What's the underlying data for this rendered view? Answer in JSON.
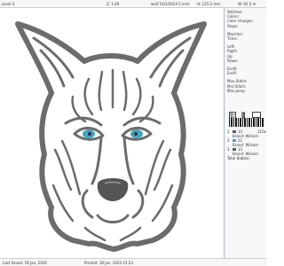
{
  "topbar": {
    "level": "Level 3",
    "zoom": "Z: 1.49",
    "file": "wolf 10/1/2024 5 inch",
    "dims": "H: 125.2 mm",
    "width": "W: 92.5 m"
  },
  "panel": {
    "stitches": "Stitches:",
    "colors": "Colors:",
    "color_changes": "Color changes:",
    "stops": "Stops:",
    "machine": "Machine:",
    "trims": "Trims:",
    "left": "Left:",
    "right": "Right:",
    "up": "Up:",
    "down": "Down:",
    "endx": "EndX:",
    "endy": "EndY:",
    "max_stitch": "Max.Stitch:",
    "min_stitch": "Min.Stitch:",
    "max_jump": "Max.Jump:"
  },
  "toolbar": {
    "icon1": "grid-icon",
    "icon2": "ruler-icon",
    "icon3": "monitor-icon"
  },
  "color_table": [
    {
      "index": "1",
      "code": "13",
      "stitches": "110x",
      "color": "#5a5a5a"
    },
    {
      "index": "",
      "code": "Brand: Wilcom",
      "stitches": "",
      "color": ""
    },
    {
      "index": "2",
      "code": "21",
      "stitches": "",
      "color": "#3aa0c8"
    },
    {
      "index": "",
      "code": "Brand: Wilcom",
      "stitches": "",
      "color": ""
    },
    {
      "index": "3",
      "code": "13",
      "stitches": "",
      "color": "#5a5a5a"
    },
    {
      "index": "",
      "code": "Brand: Wilcom",
      "stitches": "",
      "color": ""
    }
  ],
  "total": "Total Bobbin:",
  "statusbar": {
    "saved": "Last Saved: 18 Jan, 2024",
    "printed": "Printed: 18 Jan, 2024 15:23"
  }
}
